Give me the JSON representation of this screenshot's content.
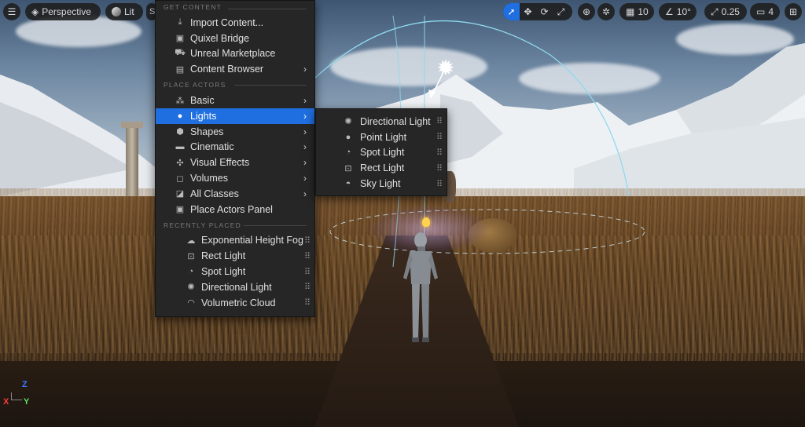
{
  "toolbar": {
    "view_mode": "Perspective",
    "lighting_mode": "Lit",
    "grid_value": "10",
    "angle_value": "10°",
    "scale_value": "0.25",
    "camera_speed": "4"
  },
  "axes": {
    "x": "X",
    "y": "Y",
    "z": "Z"
  },
  "main_menu": {
    "get_content_header": "GET CONTENT",
    "get_content": [
      {
        "label": "Import Content...",
        "icon": "import-icon"
      },
      {
        "label": "Quixel Bridge",
        "icon": "bridge-icon"
      },
      {
        "label": "Unreal Marketplace",
        "icon": "marketplace-icon"
      },
      {
        "label": "Content Browser",
        "icon": "content-browser-icon"
      }
    ],
    "place_actors_header": "PLACE ACTORS",
    "place_actors": [
      {
        "label": "Basic",
        "icon": "basic-icon"
      },
      {
        "label": "Lights",
        "icon": "light-bulb-icon"
      },
      {
        "label": "Shapes",
        "icon": "shapes-icon"
      },
      {
        "label": "Cinematic",
        "icon": "cinematic-icon"
      },
      {
        "label": "Visual Effects",
        "icon": "visual-effects-icon"
      },
      {
        "label": "Volumes",
        "icon": "volumes-icon"
      },
      {
        "label": "All Classes",
        "icon": "all-classes-icon"
      },
      {
        "label": "Place Actors Panel",
        "icon": "place-actors-panel-icon"
      }
    ],
    "recently_placed_header": "RECENTLY PLACED",
    "recently_placed": [
      {
        "label": "Exponential Height Fog",
        "icon": "fog-icon"
      },
      {
        "label": "Rect Light",
        "icon": "rect-light-icon"
      },
      {
        "label": "Spot Light",
        "icon": "spot-light-icon"
      },
      {
        "label": "Directional Light",
        "icon": "directional-light-icon"
      },
      {
        "label": "Volumetric Cloud",
        "icon": "cloud-icon"
      }
    ]
  },
  "lights_submenu": [
    {
      "label": "Directional Light",
      "icon": "directional-light-icon"
    },
    {
      "label": "Point Light",
      "icon": "point-light-icon"
    },
    {
      "label": "Spot Light",
      "icon": "spot-light-icon"
    },
    {
      "label": "Rect Light",
      "icon": "rect-light-icon"
    },
    {
      "label": "Sky Light",
      "icon": "sky-light-icon"
    }
  ],
  "colors": {
    "accent": "#1f6fe0",
    "menu_bg": "#262626"
  }
}
